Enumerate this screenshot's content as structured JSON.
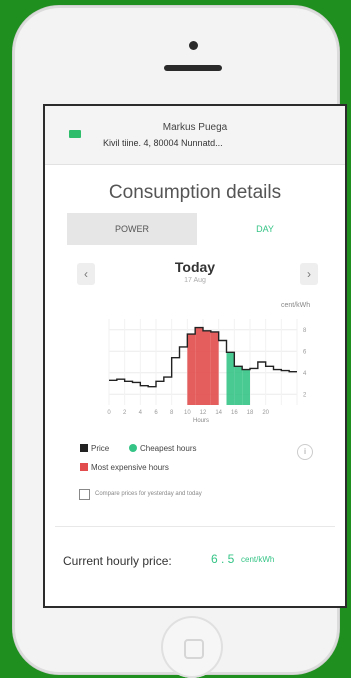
{
  "header": {
    "name": "Markus Puega",
    "address": "Kivil tiine. 4, 80004 Nunnatd..."
  },
  "page": {
    "title": "Consumption details"
  },
  "tabs": [
    {
      "label": "POWER"
    },
    {
      "label": "DAY"
    }
  ],
  "nav": {
    "day_label": "Today",
    "date_sub": "17 Aug",
    "prev_icon": "chevron-left-icon",
    "next_icon": "chevron-right-icon"
  },
  "chart_data": {
    "type": "line",
    "unit_label": "cent/kWh",
    "xlabel": "Hours",
    "x": [
      0,
      1,
      2,
      3,
      4,
      5,
      6,
      7,
      8,
      9,
      10,
      11,
      12,
      13,
      14,
      15,
      16,
      17,
      18,
      19,
      20,
      21,
      22,
      23
    ],
    "x_ticks": [
      "0",
      "2",
      "4",
      "6",
      "8",
      "10",
      "12",
      "14",
      "16",
      "18",
      "20"
    ],
    "y_ticks": [
      "2",
      "4",
      "6",
      "8"
    ],
    "ylim": [
      1,
      9
    ],
    "series": [
      {
        "values": [
          3.3,
          3.4,
          3.2,
          3.1,
          2.8,
          2.7,
          3.2,
          3.6,
          5.4,
          6.4,
          7.6,
          8.2,
          7.9,
          7.8,
          7.0,
          5.9,
          4.6,
          4.3,
          4.4,
          5.0,
          4.6,
          4.3,
          4.2,
          4.1
        ]
      }
    ],
    "expensive_hours": [
      10,
      13
    ],
    "cheapest_hours": [
      15,
      17
    ],
    "colors": {
      "line": "#222222",
      "expensive": "#e24c4c",
      "cheapest": "#35c486"
    }
  },
  "legend": {
    "price": "Price",
    "cheapest": "Cheapest hours",
    "expensive": "Most expensive hours"
  },
  "compare": {
    "label": "Compare prices for yesterday and today"
  },
  "current": {
    "label": "Current hourly price:",
    "value": "6 . 5",
    "unit": "cent/kWh"
  },
  "colors": {
    "accent": "#35c486",
    "expensive": "#e24c4c",
    "background": "#1f8f1f"
  }
}
